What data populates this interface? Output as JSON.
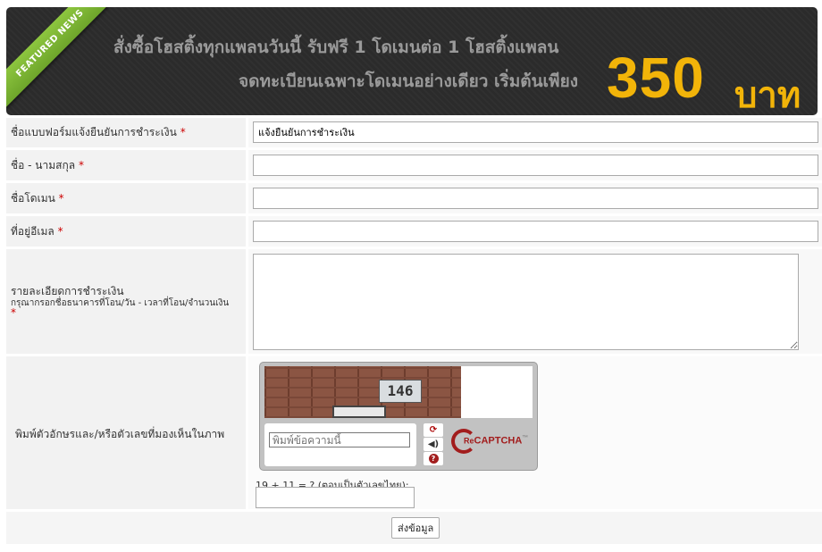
{
  "banner": {
    "ribbon": "FEATURED NEWS",
    "line1": "สั่งซื้อโฮสติ้งทุกแพลนวันนี้ รับฟรี 1 โดเมนต่อ 1 โฮสติ้งแพลน",
    "line2": "จดทะเบียนเฉพาะโดเมนอย่างเดียว เริ่มต้นเพียง",
    "price": "350",
    "unit": "บาท",
    "price_color": "#f2b409"
  },
  "form": {
    "form_name_label": "ชื่อแบบฟอร์มแจ้งยืนยันการชำระเงิน",
    "form_name_value": "แจ้งยืนยันการชำระเงิน",
    "fullname_label": "ชื่อ - นามสกุล",
    "fullname_value": "",
    "domain_label": "ชื่อโดเมน",
    "domain_value": "",
    "email_label": "ที่อยู่อีเมล",
    "email_value": "",
    "details_label": "รายละเอียดการชำระเงิน",
    "details_hint": "กรุณากรอกชื่อธนาคารที่โอน/วัน - เวลาที่โอน/จำนวนเงิน",
    "required_mark": "*",
    "captcha_label": "พิมพ์ตัวอักษรและ/หรือตัวเลขที่มองเห็นในภาพ",
    "captcha_image_text": "146",
    "captcha_placeholder": "พิมพ์ข้อความนี้",
    "captcha_logo_pre": "Re",
    "captcha_logo": "CAPTCHA",
    "captcha_tm": "™",
    "captcha_buttons": [
      "refresh-icon",
      "audio-icon",
      "help-icon"
    ],
    "math_question": "19 + 11 = ? (ตอบเป็นตัวเลขไทย):",
    "submit_label": "ส่งข้อมูล"
  }
}
